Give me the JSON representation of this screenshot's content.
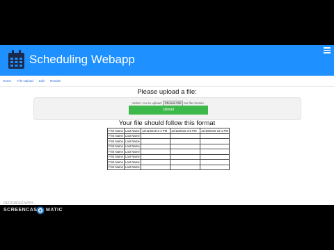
{
  "header": {
    "title": "Scheduling Webapp",
    "icon": "calendar-icon",
    "brand_color": "#1e90ff",
    "menu_icon": "hamburger-icon"
  },
  "nav": {
    "items": [
      "Home",
      "File Upload",
      "Edit",
      "Results"
    ]
  },
  "upload": {
    "heading": "Please upload a file:",
    "file_label": "Select .csv to upload:",
    "choose_label": "Choose File",
    "no_file_text": "No file chosen",
    "upload_button": "Upload",
    "upload_color": "#3db84a"
  },
  "format": {
    "heading": "Your file should follow this format",
    "header_row": [
      "First Name",
      "Last Name",
      "12/11/2018 2-4 PM",
      "12/15/2018 3-5 PM",
      "12/18/2018 12-1 PM"
    ],
    "rows": [
      [
        "First Name",
        "Last Name",
        "",
        "",
        ""
      ],
      [
        "First Name",
        "Last Name",
        "",
        "",
        ""
      ],
      [
        "First Name",
        "Last Name",
        "",
        "",
        ""
      ],
      [
        "First Name",
        "Last Name",
        "",
        "",
        ""
      ],
      [
        "First Name",
        "Last Name",
        "",
        "",
        ""
      ],
      [
        "First Name",
        "Last Name",
        "",
        "",
        ""
      ],
      [
        "First Name",
        "Last Name",
        "",
        "",
        ""
      ]
    ]
  },
  "watermark": {
    "recorded_with": "RECORDED WITH",
    "brand_left": "SCREENCAST",
    "brand_right": "MATIC"
  }
}
